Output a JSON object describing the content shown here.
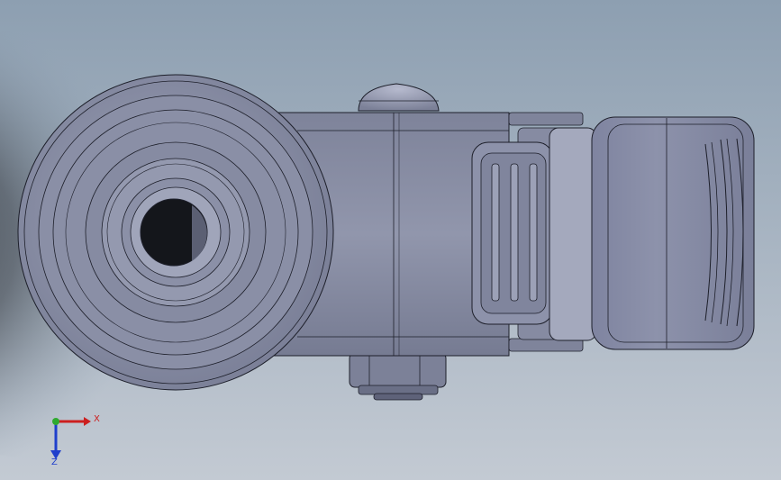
{
  "colors": {
    "background_top": "#8d9fb1",
    "background_bottom": "#c3cad3",
    "shadow": "#1f2327",
    "part_body": "#8a8fa6",
    "part_light": "#a3a8bd",
    "part_dark": "#5e6279",
    "edge": "#1d1f2a",
    "axis_x": "#cc1f1f",
    "axis_y": "#2faa2f",
    "axis_z": "#1f3fcc"
  },
  "triad": {
    "x_label": "X",
    "z_label": "Z"
  },
  "model": {
    "view": "top",
    "parts": [
      "wheel",
      "axle-hole",
      "housing",
      "top-knob",
      "bottom-nut",
      "cam-latch",
      "brake-pedal"
    ]
  }
}
